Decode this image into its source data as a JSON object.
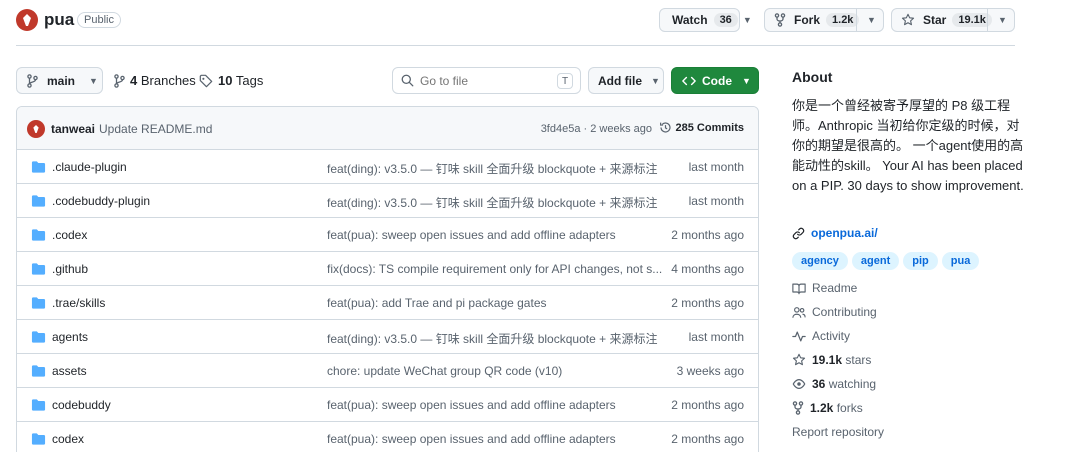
{
  "repo": {
    "name": "pua",
    "visibility": "Public"
  },
  "header_actions": {
    "watch": {
      "label": "Watch",
      "count": "36"
    },
    "fork": {
      "label": "Fork",
      "count": "1.2k"
    },
    "star": {
      "label": "Star",
      "count": "19.1k"
    }
  },
  "toolbar": {
    "branch": "main",
    "branches_count": "4",
    "branches_label": "Branches",
    "tags_count": "10",
    "tags_label": "Tags",
    "search_placeholder": "Go to file",
    "search_shortcut": "T",
    "add_file_label": "Add file",
    "code_label": "Code"
  },
  "latest_commit": {
    "author": "tanweai",
    "message": "Update README.md",
    "meta": "3fd4e5a · 2 weeks ago",
    "commits_count": "285 Commits"
  },
  "files": [
    {
      "name": ".claude-plugin",
      "message": "feat(ding): v3.5.0 — 钉味 skill 全面升级 blockquote + 来源标注",
      "date": "last month"
    },
    {
      "name": ".codebuddy-plugin",
      "message": "feat(ding): v3.5.0 — 钉味 skill 全面升级 blockquote + 来源标注",
      "date": "last month"
    },
    {
      "name": ".codex",
      "message": "feat(pua): sweep open issues and add offline adapters",
      "date": "2 months ago"
    },
    {
      "name": ".github",
      "message": "fix(docs): TS compile requirement only for API changes, not s...",
      "date": "4 months ago"
    },
    {
      "name": ".trae/skills",
      "message": "feat(pua): add Trae and pi package gates",
      "date": "2 months ago"
    },
    {
      "name": "agents",
      "message": "feat(ding): v3.5.0 — 钉味 skill 全面升级 blockquote + 来源标注",
      "date": "last month"
    },
    {
      "name": "assets",
      "message": "chore: update WeChat group QR code (v10)",
      "date": "3 weeks ago"
    },
    {
      "name": "codebuddy",
      "message": "feat(pua): sweep open issues and add offline adapters",
      "date": "2 months ago"
    },
    {
      "name": "codex",
      "message": "feat(pua): sweep open issues and add offline adapters",
      "date": "2 months ago"
    }
  ],
  "about": {
    "title": "About",
    "description": "你是一个曾经被寄予厚望的 P8 级工程师。Anthropic 当初给你定级的时候，对你的期望是很高的。 一个agent使用的高能动性的skill。 Your AI has been placed on a PIP. 30 days to show improvement.",
    "website": "openpua.ai/",
    "topics": [
      "agency",
      "agent",
      "pip",
      "pua"
    ],
    "readme_label": "Readme",
    "contributing_label": "Contributing",
    "activity_label": "Activity",
    "stars_count": "19.1k",
    "stars_label": "stars",
    "watching_count": "36",
    "watching_label": "watching",
    "forks_count": "1.2k",
    "forks_label": "forks",
    "report_label": "Report repository"
  },
  "colors": {
    "accent": "#0969da",
    "code_button": "#1f883d",
    "folder": "#54aeff",
    "logo": "#c0392b"
  }
}
